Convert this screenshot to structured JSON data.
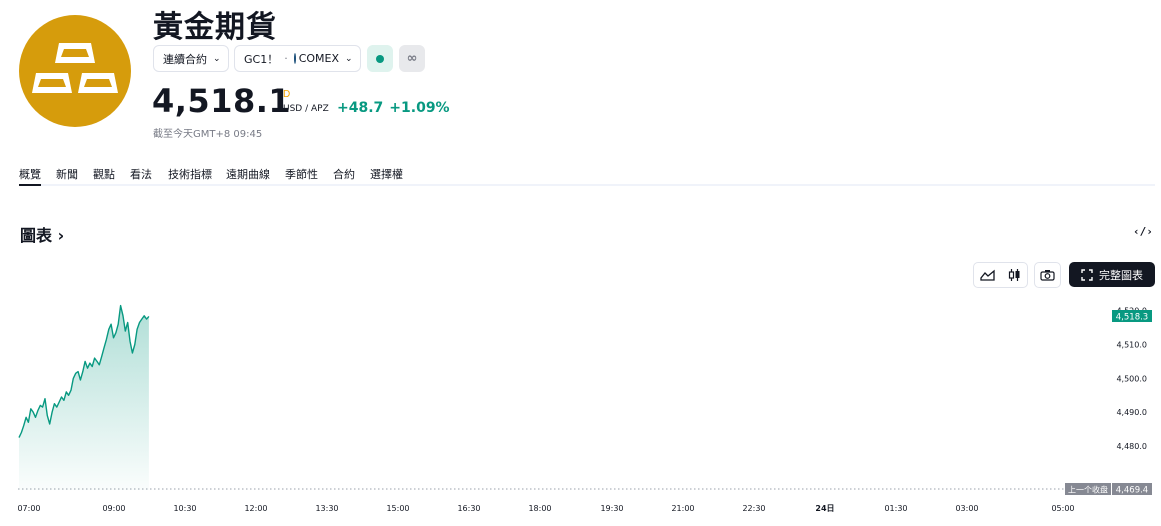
{
  "header": {
    "title": "黃金期貨",
    "contract_selector": "連續合約",
    "symbol": "GC1！",
    "exchange": "COMEX"
  },
  "quote": {
    "price": "4,518.1",
    "flag": "D",
    "currency": "USD / APZ",
    "change": "+48.7",
    "change_pct": "+1.09%",
    "as_of": "截至今天GMT+8 09:45"
  },
  "tabs": [
    "概覽",
    "新聞",
    "觀點",
    "看法",
    "技術指標",
    "遠期曲線",
    "季節性",
    "合約",
    "選擇權"
  ],
  "section": {
    "title": "圖表",
    "embed_label": "‹/›",
    "fullscreen_label": "完整圖表"
  },
  "colors": {
    "accent": "#089981",
    "logo": "#d69c0c",
    "flag": "#f7a600"
  },
  "chart_data": {
    "type": "area",
    "x_ticks": [
      "07:00",
      "09:00",
      "10:30",
      "12:00",
      "13:30",
      "15:00",
      "16:30",
      "18:00",
      "19:30",
      "21:00",
      "22:30",
      "24日",
      "01:30",
      "03:00",
      "05:00"
    ],
    "y_ticks": [
      "4,520.0",
      "4,510.0",
      "4,500.0",
      "4,490.0",
      "4,480.0"
    ],
    "ylim": [
      4467,
      4520.5
    ],
    "last_price_label": "4,518.3",
    "prev_close_text": "上一个收盘",
    "prev_close_value": "4,469.4",
    "series_minutes": [
      0,
      3,
      6,
      9,
      12,
      15,
      18,
      21,
      24,
      27,
      30,
      33,
      36,
      39,
      42,
      45,
      48,
      51,
      54,
      57,
      60,
      63,
      66,
      69,
      72,
      75,
      78,
      81,
      84,
      87,
      90,
      93,
      96,
      99,
      102,
      105,
      108,
      111,
      114,
      117,
      120,
      123,
      126,
      129,
      132,
      135,
      138,
      141,
      144,
      147,
      150,
      153,
      156,
      159,
      162,
      165
    ],
    "series_values": [
      4482.5,
      4484,
      4486,
      4488.5,
      4487,
      4491,
      4490,
      4488.5,
      4490.5,
      4492,
      4491.5,
      4494,
      4489,
      4486.5,
      4490,
      4492.5,
      4491.5,
      4493,
      4494.5,
      4493.5,
      4496,
      4495,
      4496.5,
      4500,
      4501.5,
      4502,
      4499.5,
      4502,
      4505,
      4503,
      4504.5,
      4503.5,
      4506,
      4505,
      4504,
      4506.5,
      4509,
      4511.5,
      4514.5,
      4516,
      4512,
      4513.5,
      4516,
      4521.5,
      4518.5,
      4514,
      4516.5,
      4511,
      4507.5,
      4510,
      4514.5,
      4516.5,
      4517.5,
      4518.5,
      4517.5,
      4518.3
    ]
  }
}
